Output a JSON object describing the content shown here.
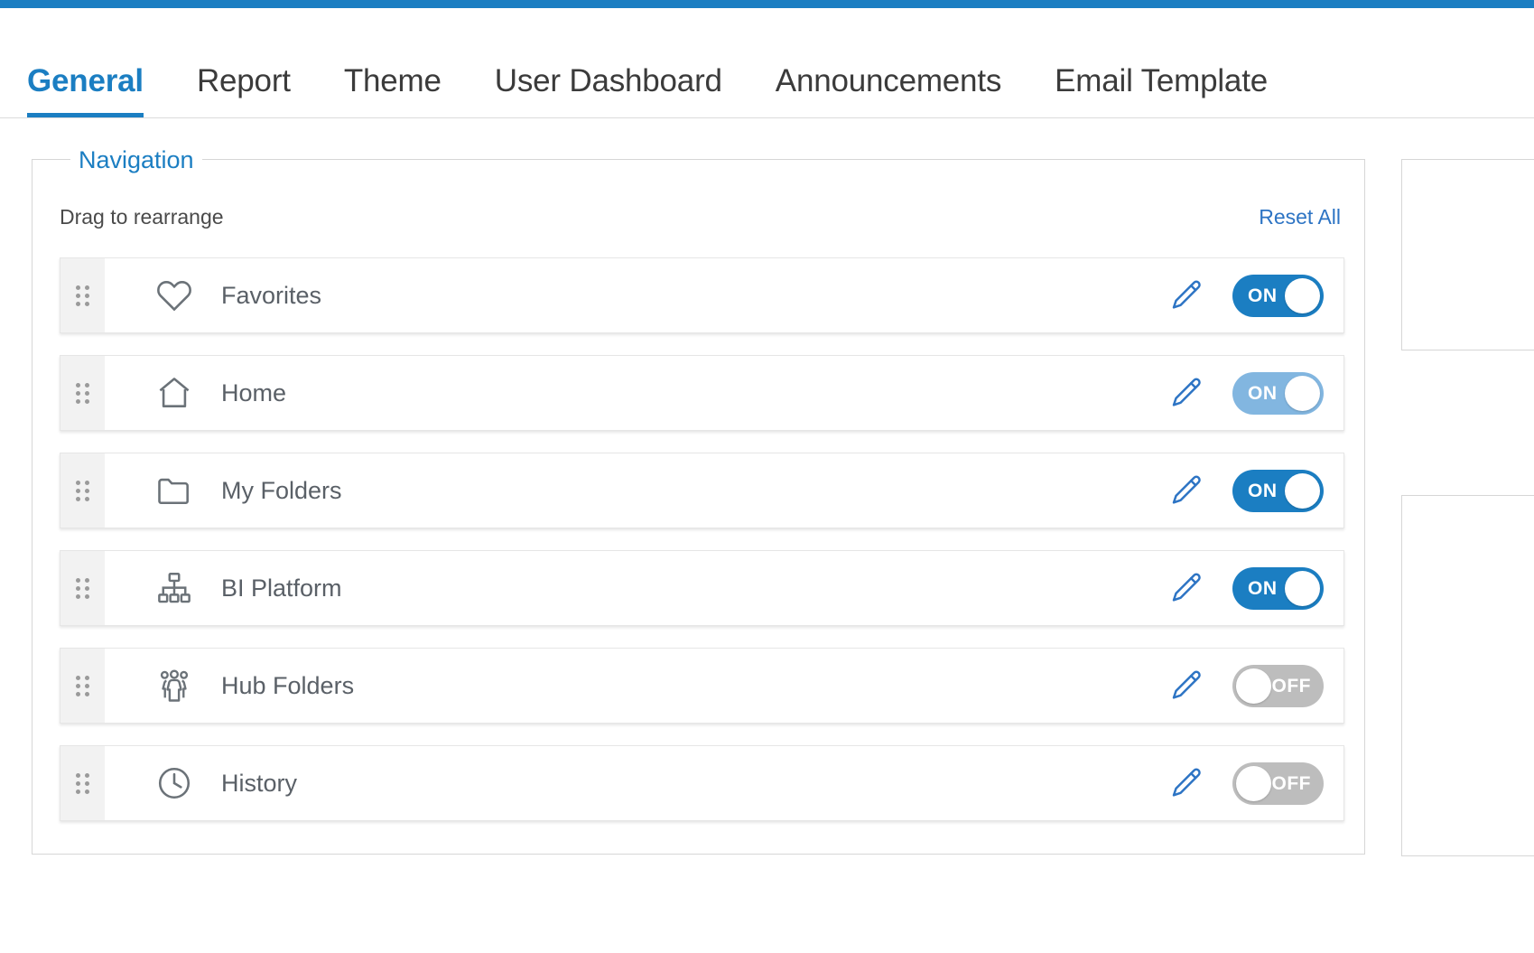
{
  "theme": {
    "accent": "#1b7ec2",
    "link": "#2d74c4",
    "toggle_on": "#1b7ec2",
    "toggle_on_light": "#82b6e0",
    "toggle_off": "#bdbdbd",
    "label_text": "#5a6067",
    "icon_gray": "#6b7278"
  },
  "tabs": [
    {
      "label": "General",
      "active": true
    },
    {
      "label": "Report",
      "active": false
    },
    {
      "label": "Theme",
      "active": false
    },
    {
      "label": "User Dashboard",
      "active": false
    },
    {
      "label": "Announcements",
      "active": false
    },
    {
      "label": "Email Template",
      "active": false
    }
  ],
  "navigation_panel": {
    "legend": "Navigation",
    "subhead": "Drag to rearrange",
    "reset_all": "Reset All",
    "rows": [
      {
        "label": "Favorites",
        "icon": "heart-icon",
        "toggle_label": "ON",
        "toggle_state": "on",
        "edit_icon": "pencil-icon",
        "drag_icon": "drag-handle-icon"
      },
      {
        "label": "Home",
        "icon": "home-icon",
        "toggle_label": "ON",
        "toggle_state": "on-light",
        "edit_icon": "pencil-icon",
        "drag_icon": "drag-handle-icon"
      },
      {
        "label": "My Folders",
        "icon": "folder-icon",
        "toggle_label": "ON",
        "toggle_state": "on",
        "edit_icon": "pencil-icon",
        "drag_icon": "drag-handle-icon"
      },
      {
        "label": "BI Platform",
        "icon": "sitemap-icon",
        "toggle_label": "ON",
        "toggle_state": "on",
        "edit_icon": "pencil-icon",
        "drag_icon": "drag-handle-icon"
      },
      {
        "label": "Hub Folders",
        "icon": "users-group-icon",
        "toggle_label": "OFF",
        "toggle_state": "off",
        "edit_icon": "pencil-icon",
        "drag_icon": "drag-handle-icon"
      },
      {
        "label": "History",
        "icon": "clock-icon",
        "toggle_label": "OFF",
        "toggle_state": "off",
        "edit_icon": "pencil-icon",
        "drag_icon": "drag-handle-icon"
      }
    ]
  }
}
